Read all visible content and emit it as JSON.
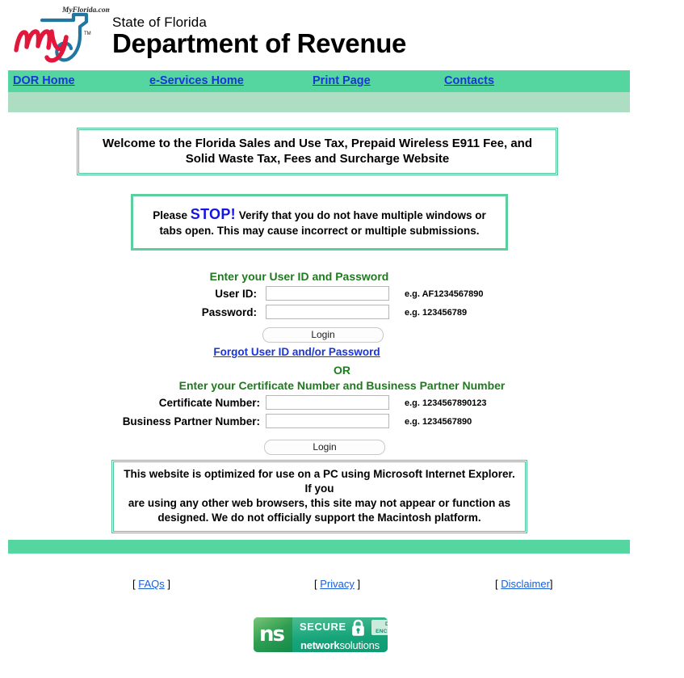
{
  "header": {
    "logo_alt": "MyFlorida.com",
    "logo_wordmark": "my",
    "logo_tm": "TM",
    "title_small": "State of Florida",
    "title_large": "Department of Revenue"
  },
  "nav": {
    "items": [
      {
        "label": "DOR Home"
      },
      {
        "label": "e-Services Home"
      },
      {
        "label": "Print Page"
      },
      {
        "label": "Contacts"
      }
    ]
  },
  "welcome": {
    "line1": "Welcome to the Florida Sales and Use Tax, Prepaid Wireless E911 Fee, and",
    "line2": "Solid Waste Tax, Fees and Surcharge Website"
  },
  "stop_notice": {
    "prefix": "Please ",
    "keyword": "STOP!",
    "body": " Verify that you do not have multiple windows or tabs open. This may cause incorrect or multiple submissions."
  },
  "login_form": {
    "heading": "Enter your User ID and Password",
    "fields": [
      {
        "label": "User ID:",
        "value": "",
        "placeholder": "",
        "hint": "e.g. AF1234567890"
      },
      {
        "label": "Password:",
        "value": "",
        "placeholder": "",
        "hint": "e.g. 123456789"
      }
    ],
    "submit_label": "Login",
    "forgot_label": "Forgot User ID and/or Password"
  },
  "divider_label": "OR",
  "cert_form": {
    "heading": "Enter your Certificate Number and Business Partner Number",
    "fields": [
      {
        "label": "Certificate Number:",
        "value": "",
        "placeholder": "",
        "hint": "e.g. 1234567890123"
      },
      {
        "label": "Business Partner Number:",
        "value": "",
        "placeholder": "",
        "hint": "e.g. 1234567890"
      }
    ],
    "submit_label": "Login"
  },
  "browser_notice": {
    "line1": "This website is optimized for use on a PC using Microsoft Internet Explorer. If you",
    "line2": "are using any other web browsers, this site may not appear or function as",
    "line3": "designed. We do not officially support the Macintosh platform."
  },
  "footer": {
    "links": [
      {
        "open": "[ ",
        "label": "FAQs",
        "close": " ]"
      },
      {
        "open": "[ ",
        "label": "Privacy",
        "close": " ]"
      },
      {
        "open": "[ ",
        "label": "Disclaimer",
        "close": "]"
      }
    ]
  },
  "seal": {
    "logo_text": "ns",
    "secure_label": "SECURE",
    "badge_line1": "DATA",
    "badge_line2": "ENCRYPTED",
    "brand_bold": "network",
    "brand_light": "solutions"
  },
  "colors": {
    "nav_green": "#55d6a0",
    "subbar_green": "#addec3",
    "box_border_green": "#4fc795",
    "heading_green": "#1f7a1f",
    "link_blue": "#1a35d8",
    "stop_blue": "#1414e6",
    "footer_link_blue": "#1a5fd8"
  }
}
